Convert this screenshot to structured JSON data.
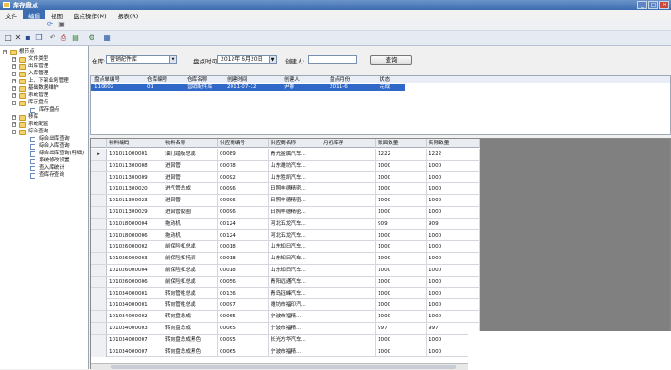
{
  "window": {
    "title": "库存盘点"
  },
  "menu": [
    "文件",
    "编辑",
    "视图",
    "盘点操作(M)",
    "报表(R)"
  ],
  "sidebar": {
    "items": [
      {
        "label": "根节点",
        "level": 0,
        "type": "folder"
      },
      {
        "label": "文件类型",
        "level": 1,
        "type": "folder"
      },
      {
        "label": "出库管理",
        "level": 1,
        "type": "folder"
      },
      {
        "label": "入库管理",
        "level": 1,
        "type": "folder"
      },
      {
        "label": "上、下架业务管理",
        "level": 1,
        "type": "folder"
      },
      {
        "label": "基础数据维护",
        "level": 1,
        "type": "folder"
      },
      {
        "label": "系统管理",
        "level": 1,
        "type": "folder"
      },
      {
        "label": "库存盘点",
        "level": 1,
        "type": "folder"
      },
      {
        "label": "库存盘点",
        "level": 2,
        "type": "doc"
      },
      {
        "label": "移库",
        "level": 1,
        "type": "folder"
      },
      {
        "label": "系统配置",
        "level": 1,
        "type": "folder"
      },
      {
        "label": "综合查询",
        "level": 1,
        "type": "folder"
      },
      {
        "label": "综合出库查询",
        "level": 2,
        "type": "doc"
      },
      {
        "label": "综合入库查询",
        "level": 2,
        "type": "doc"
      },
      {
        "label": "综合出库查询(明细)",
        "level": 2,
        "type": "doc"
      },
      {
        "label": "系统修改设置",
        "level": 2,
        "type": "doc"
      },
      {
        "label": "查入库统计",
        "level": 2,
        "type": "doc"
      },
      {
        "label": "查库存查询",
        "level": 2,
        "type": "doc"
      }
    ]
  },
  "filters": {
    "warehouse_label": "仓库:",
    "warehouse_value": "营销配件库",
    "date_label": "盘点时间",
    "date_value": "2012年 6月20日",
    "creator_label": "创建人:",
    "creator_value": "",
    "search_button": "查询"
  },
  "upper_table": {
    "headers": [
      "盘点单编号",
      "仓库编号",
      "仓库名称",
      "创建时间",
      "创建人",
      "盘点月份",
      "状态"
    ],
    "rows": [
      [
        "110602",
        "01",
        "营销配件库",
        "2011-07-12",
        "尹娜",
        "2011-6",
        "完成"
      ]
    ]
  },
  "lower_table": {
    "headers": [
      "物料编码",
      "物料名称",
      "供应商编号",
      "供应商名称",
      "月初库存",
      "账面数量",
      "实际数量"
    ],
    "rows": [
      [
        "101011000001",
        "油门踏板总成",
        "00089",
        "青光金属汽车...",
        "",
        "1222",
        "1222"
      ],
      [
        "101011300008",
        "进回管",
        "00078",
        "山东潍坊汽车...",
        "",
        "1000",
        "1000"
      ],
      [
        "101011300009",
        "进回管",
        "00092",
        "山东胜凯汽车...",
        "",
        "1000",
        "1000"
      ],
      [
        "101011300020",
        "进气管总成",
        "00096",
        "日照丰德精密...",
        "",
        "1000",
        "1000"
      ],
      [
        "101011300023",
        "进回管",
        "00096",
        "日照丰德精密...",
        "",
        "1000",
        "1000"
      ],
      [
        "101011300029",
        "进回管胶圈",
        "00096",
        "日照丰德精密...",
        "",
        "1000",
        "1000"
      ],
      [
        "101018000004",
        "拖动机",
        "00124",
        "河北五龙汽车...",
        "",
        "909",
        "909"
      ],
      [
        "101018000006",
        "拖动机",
        "00124",
        "河北五龙汽车...",
        "",
        "1000",
        "1000"
      ],
      [
        "101026000002",
        "前保险杠总成",
        "00018",
        "山东知日汽车...",
        "",
        "1000",
        "1000"
      ],
      [
        "101026000003",
        "前保险杠托架",
        "00018",
        "山东知日汽车...",
        "",
        "1000",
        "1000"
      ],
      [
        "101026000004",
        "前保险杠总成",
        "00018",
        "山东知日汽车...",
        "",
        "1000",
        "1000"
      ],
      [
        "101026000006",
        "前保险杠总成",
        "00056",
        "青阳远通汽车...",
        "",
        "1000",
        "1000"
      ],
      [
        "101034000001",
        "转向管柱总成",
        "00136",
        "青岛钰峰汽车...",
        "",
        "1000",
        "1000"
      ],
      [
        "101034000001",
        "转向管柱总成",
        "00097",
        "潍坊市福印汽...",
        "",
        "1000",
        "1000"
      ],
      [
        "101034000002",
        "转向盘总成",
        "00065",
        "宁波市福精...",
        "",
        "1000",
        "1000"
      ],
      [
        "101034000003",
        "转向盘总成",
        "00065",
        "宁波市福精...",
        "",
        "997",
        "997"
      ],
      [
        "101034000007",
        "转向盘总成黑色",
        "00095",
        "长光方华汽车...",
        "",
        "1000",
        "1000"
      ],
      [
        "101034000007",
        "转向盘总成黑色",
        "00065",
        "宁波市福精...",
        "",
        "1000",
        "1000"
      ]
    ]
  }
}
